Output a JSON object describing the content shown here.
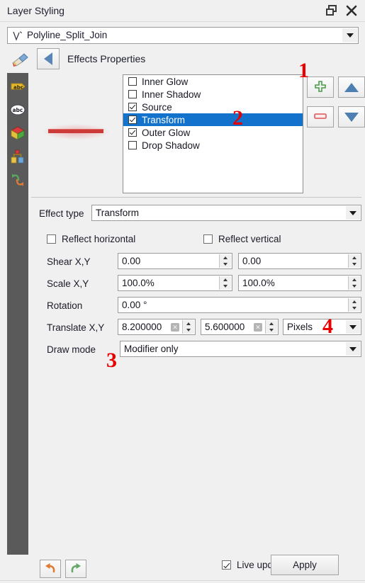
{
  "window": {
    "title": "Layer Styling",
    "undock_icon": "undock-icon",
    "close_icon": "close-icon"
  },
  "layer_selector": {
    "value": "Polyline_Split_Join",
    "icon": "vector-line-layer-icon"
  },
  "header": {
    "brush_icon": "paintbrush-icon",
    "back_icon": "back-arrow-icon",
    "caption": "Effects Properties"
  },
  "sidebar": {
    "items": [
      {
        "icon": "labels-icon"
      },
      {
        "icon": "abc-callout-icon"
      },
      {
        "icon": "3d-view-icon"
      },
      {
        "icon": "diagram-icon"
      },
      {
        "icon": "undo-redo-history-icon"
      }
    ]
  },
  "preview": {
    "name": "symbol-preview",
    "line_color": "#cc3b38",
    "glow_color": "#df4642"
  },
  "effects_list": {
    "items": [
      {
        "label": "Inner Glow",
        "checked": false,
        "selected": false
      },
      {
        "label": "Inner Shadow",
        "checked": false,
        "selected": false
      },
      {
        "label": "Source",
        "checked": true,
        "selected": false
      },
      {
        "label": "Transform",
        "checked": true,
        "selected": true
      },
      {
        "label": "Outer Glow",
        "checked": true,
        "selected": false
      },
      {
        "label": "Drop Shadow",
        "checked": false,
        "selected": false
      }
    ]
  },
  "list_tools": {
    "add_icon": "plus-icon",
    "remove_icon": "minus-icon",
    "move_up_icon": "triangle-up-icon",
    "move_down_icon": "triangle-down-icon",
    "add_color": "#4f9a4f",
    "remove_color": "#e2686a",
    "arrow_color": "#4d7fb3"
  },
  "form": {
    "effect_type_label": "Effect type",
    "effect_type_value": "Transform",
    "reflect_horizontal_label": "Reflect horizontal",
    "reflect_horizontal_checked": false,
    "reflect_vertical_label": "Reflect vertical",
    "reflect_vertical_checked": false,
    "shear_label": "Shear X,Y",
    "shear_x": "0.00",
    "shear_y": "0.00",
    "scale_label": "Scale X,Y",
    "scale_x": "100.0%",
    "scale_y": "100.0%",
    "rotation_label": "Rotation",
    "rotation_value": "0.00 °",
    "translate_label": "Translate X,Y",
    "translate_x": "8.200000",
    "translate_y": "5.600000",
    "translate_units": "Pixels",
    "clear_icon": "clear-value-icon",
    "draw_mode_label": "Draw mode",
    "draw_mode_value": "Modifier only"
  },
  "annotations": [
    {
      "text": "1"
    },
    {
      "text": "2"
    },
    {
      "text": "3"
    },
    {
      "text": "4"
    }
  ],
  "footer": {
    "undo_icon": "undo-arrow-icon",
    "redo_icon": "redo-arrow-icon",
    "live_update_label": "Live update",
    "live_update_checked": true,
    "apply_label": "Apply"
  }
}
